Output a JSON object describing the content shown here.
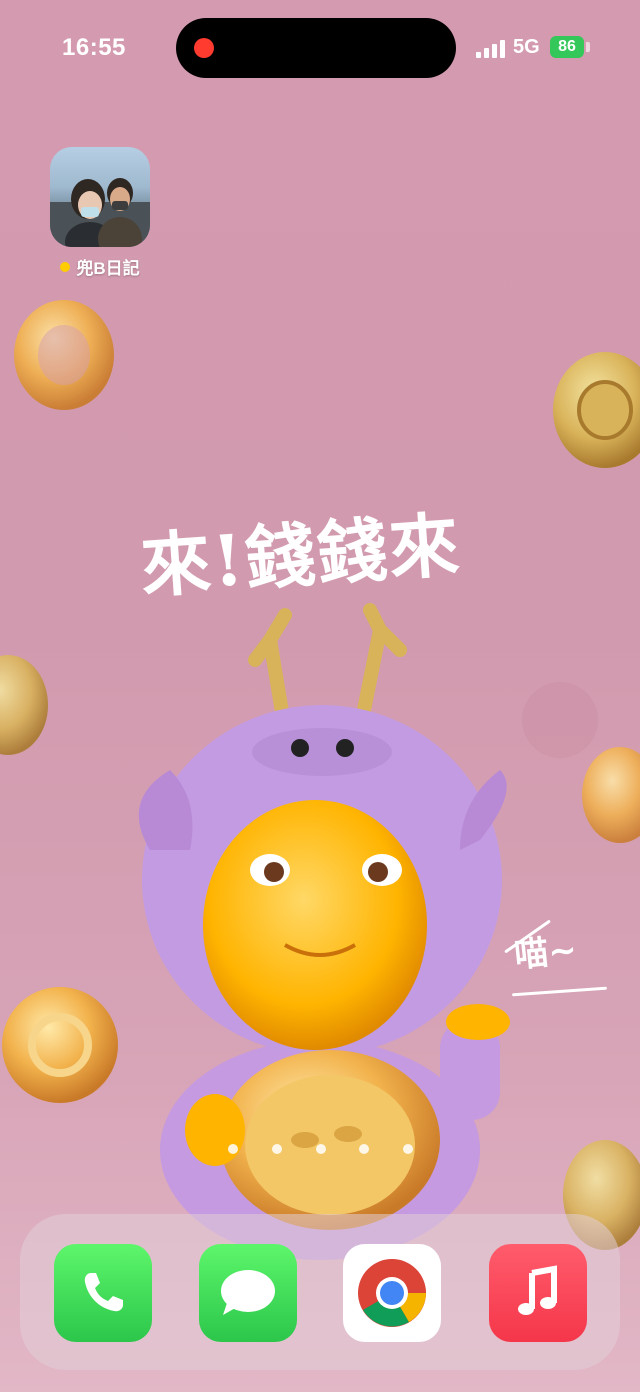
{
  "status_bar": {
    "time": "16:55",
    "network": "5G",
    "battery": "86",
    "recording_indicator": "red-dot",
    "colors": {
      "battery": "#34c759",
      "record": "#ff3b30"
    }
  },
  "home_apps": [
    {
      "label": "兜B日記",
      "icon": "photo-widget-icon",
      "status_dot_color": "#ffcc00"
    }
  ],
  "wallpaper": {
    "headline": "來!錢錢來",
    "side_text": "喵~"
  },
  "page_indicator": {
    "count": 5
  },
  "dock": [
    {
      "name": "Phone",
      "icon": "phone-icon"
    },
    {
      "name": "Messages",
      "icon": "messages-icon"
    },
    {
      "name": "Chrome",
      "icon": "chrome-icon"
    },
    {
      "name": "Music",
      "icon": "music-icon"
    }
  ]
}
